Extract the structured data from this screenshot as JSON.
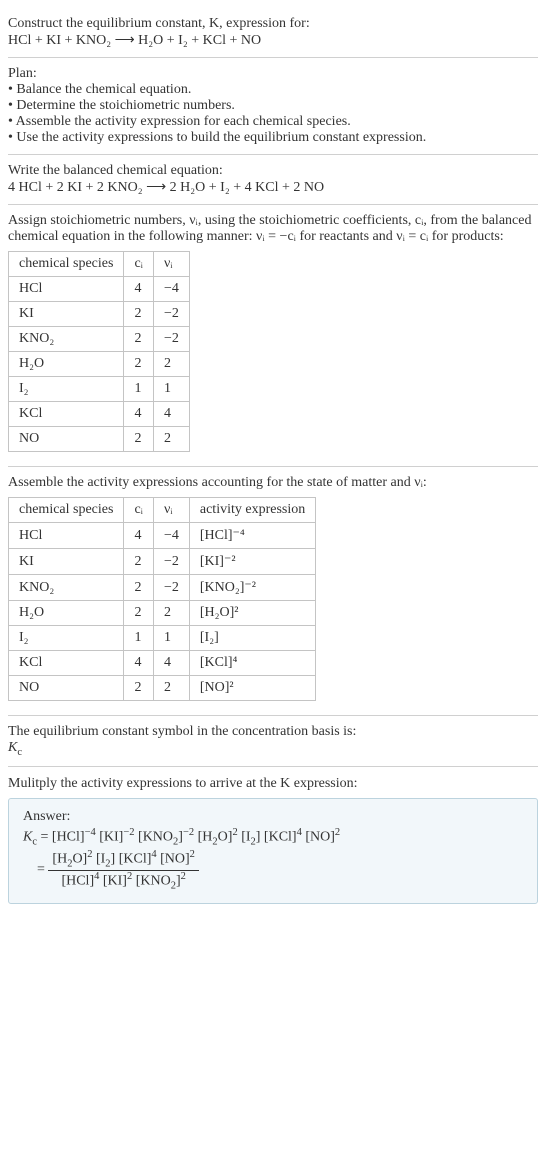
{
  "intro": {
    "line1": "Construct the equilibrium constant, K, expression for:",
    "equation": "HCl + KI + KNO₂  ⟶  H₂O + I₂ + KCl + NO"
  },
  "plan": {
    "heading": "Plan:",
    "items": [
      "• Balance the chemical equation.",
      "• Determine the stoichiometric numbers.",
      "• Assemble the activity expression for each chemical species.",
      "• Use the activity expressions to build the equilibrium constant expression."
    ]
  },
  "balanced": {
    "heading": "Write the balanced chemical equation:",
    "equation": "4 HCl + 2 KI + 2 KNO₂  ⟶  2 H₂O + I₂ + 4 KCl + 2 NO"
  },
  "stoich": {
    "heading": "Assign stoichiometric numbers, νᵢ, using the stoichiometric coefficients, cᵢ, from the balanced chemical equation in the following manner: νᵢ = −cᵢ for reactants and νᵢ = cᵢ for products:",
    "headers": [
      "chemical species",
      "cᵢ",
      "νᵢ"
    ],
    "rows": [
      [
        "HCl",
        "4",
        "−4"
      ],
      [
        "KI",
        "2",
        "−2"
      ],
      [
        "KNO₂",
        "2",
        "−2"
      ],
      [
        "H₂O",
        "2",
        "2"
      ],
      [
        "I₂",
        "1",
        "1"
      ],
      [
        "KCl",
        "4",
        "4"
      ],
      [
        "NO",
        "2",
        "2"
      ]
    ]
  },
  "activity": {
    "heading": "Assemble the activity expressions accounting for the state of matter and νᵢ:",
    "headers": [
      "chemical species",
      "cᵢ",
      "νᵢ",
      "activity expression"
    ],
    "rows": [
      [
        "HCl",
        "4",
        "−4",
        "[HCl]⁻⁴"
      ],
      [
        "KI",
        "2",
        "−2",
        "[KI]⁻²"
      ],
      [
        "KNO₂",
        "2",
        "−2",
        "[KNO₂]⁻²"
      ],
      [
        "H₂O",
        "2",
        "2",
        "[H₂O]²"
      ],
      [
        "I₂",
        "1",
        "1",
        "[I₂]"
      ],
      [
        "KCl",
        "4",
        "4",
        "[KCl]⁴"
      ],
      [
        "NO",
        "2",
        "2",
        "[NO]²"
      ]
    ]
  },
  "symbol": {
    "line1": "The equilibrium constant symbol in the concentration basis is:",
    "line2": "K𞁞"
  },
  "multiply": {
    "heading": "Mulitply the activity expressions to arrive at the K𞁞 expression:"
  },
  "answer": {
    "label": "Answer:",
    "line1": "K𞁞 = [HCl]⁻⁴ [KI]⁻² [KNO₂]⁻² [H₂O]² [I₂] [KCl]⁴ [NO]²",
    "frac_num": "[H₂O]² [I₂] [KCl]⁴ [NO]²",
    "frac_den": "[HCl]⁴ [KI]² [KNO₂]²",
    "eq_prefix": "= "
  },
  "chart_data": {
    "type": "table",
    "tables": [
      {
        "title": "Stoichiometric numbers",
        "columns": [
          "chemical species",
          "c_i",
          "nu_i"
        ],
        "rows": [
          {
            "chemical species": "HCl",
            "c_i": 4,
            "nu_i": -4
          },
          {
            "chemical species": "KI",
            "c_i": 2,
            "nu_i": -2
          },
          {
            "chemical species": "KNO2",
            "c_i": 2,
            "nu_i": -2
          },
          {
            "chemical species": "H2O",
            "c_i": 2,
            "nu_i": 2
          },
          {
            "chemical species": "I2",
            "c_i": 1,
            "nu_i": 1
          },
          {
            "chemical species": "KCl",
            "c_i": 4,
            "nu_i": 4
          },
          {
            "chemical species": "NO",
            "c_i": 2,
            "nu_i": 2
          }
        ]
      },
      {
        "title": "Activity expressions",
        "columns": [
          "chemical species",
          "c_i",
          "nu_i",
          "activity expression"
        ],
        "rows": [
          {
            "chemical species": "HCl",
            "c_i": 4,
            "nu_i": -4,
            "activity expression": "[HCl]^-4"
          },
          {
            "chemical species": "KI",
            "c_i": 2,
            "nu_i": -2,
            "activity expression": "[KI]^-2"
          },
          {
            "chemical species": "KNO2",
            "c_i": 2,
            "nu_i": -2,
            "activity expression": "[KNO2]^-2"
          },
          {
            "chemical species": "H2O",
            "c_i": 2,
            "nu_i": 2,
            "activity expression": "[H2O]^2"
          },
          {
            "chemical species": "I2",
            "c_i": 1,
            "nu_i": 1,
            "activity expression": "[I2]"
          },
          {
            "chemical species": "KCl",
            "c_i": 4,
            "nu_i": 4,
            "activity expression": "[KCl]^4"
          },
          {
            "chemical species": "NO",
            "c_i": 2,
            "nu_i": 2,
            "activity expression": "[NO]^2"
          }
        ]
      }
    ]
  }
}
